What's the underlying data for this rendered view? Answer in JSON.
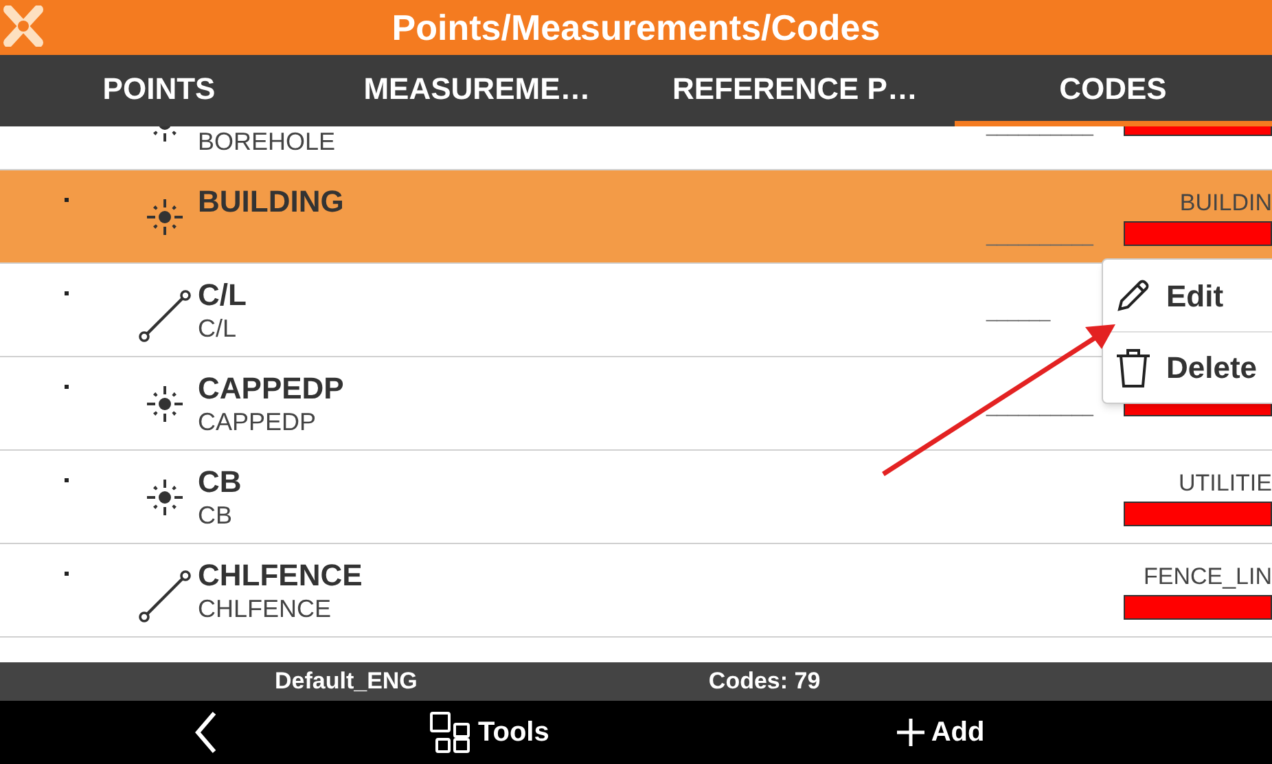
{
  "title": "Points/Measurements/Codes",
  "tabs": [
    {
      "label": "POINTS",
      "selected": false
    },
    {
      "label": "MEASUREME…",
      "selected": false
    },
    {
      "label": "REFERENCE P…",
      "selected": false
    },
    {
      "label": "CODES",
      "selected": true
    }
  ],
  "codes": [
    {
      "kind": "point",
      "description": "BOREHOLE",
      "line_style": "__________",
      "color": "#ff0000",
      "selected": false
    },
    {
      "kind": "point",
      "code": "BUILDING",
      "layer": "BUILDIN",
      "line_style": "__________",
      "color": "#ff0000",
      "selected": true
    },
    {
      "kind": "line",
      "code": "C/L",
      "description": "C/L",
      "line_style": "______",
      "selected": false
    },
    {
      "kind": "point",
      "code": "CAPPEDP",
      "description": "CAPPEDP",
      "line_style": "__________",
      "color": "#ff0000",
      "selected": false
    },
    {
      "kind": "point",
      "code": "CB",
      "description": "CB",
      "layer": "UTILITIE",
      "color": "#ff0000",
      "selected": false
    },
    {
      "kind": "line",
      "code": "CHLFENCE",
      "description": "CHLFENCE",
      "layer": "FENCE_LIN",
      "color": "#ff0000",
      "selected": false
    }
  ],
  "context_menu": [
    {
      "kind": "edit",
      "label": "Edit"
    },
    {
      "kind": "delete",
      "label": "Delete"
    }
  ],
  "status_bar": {
    "code_list": "Default_ENG",
    "count": "Codes: 79"
  },
  "nav": [
    {
      "kind": "back"
    },
    {
      "kind": "tools",
      "label": "Tools"
    },
    {
      "kind": "add",
      "label": "Add"
    }
  ]
}
